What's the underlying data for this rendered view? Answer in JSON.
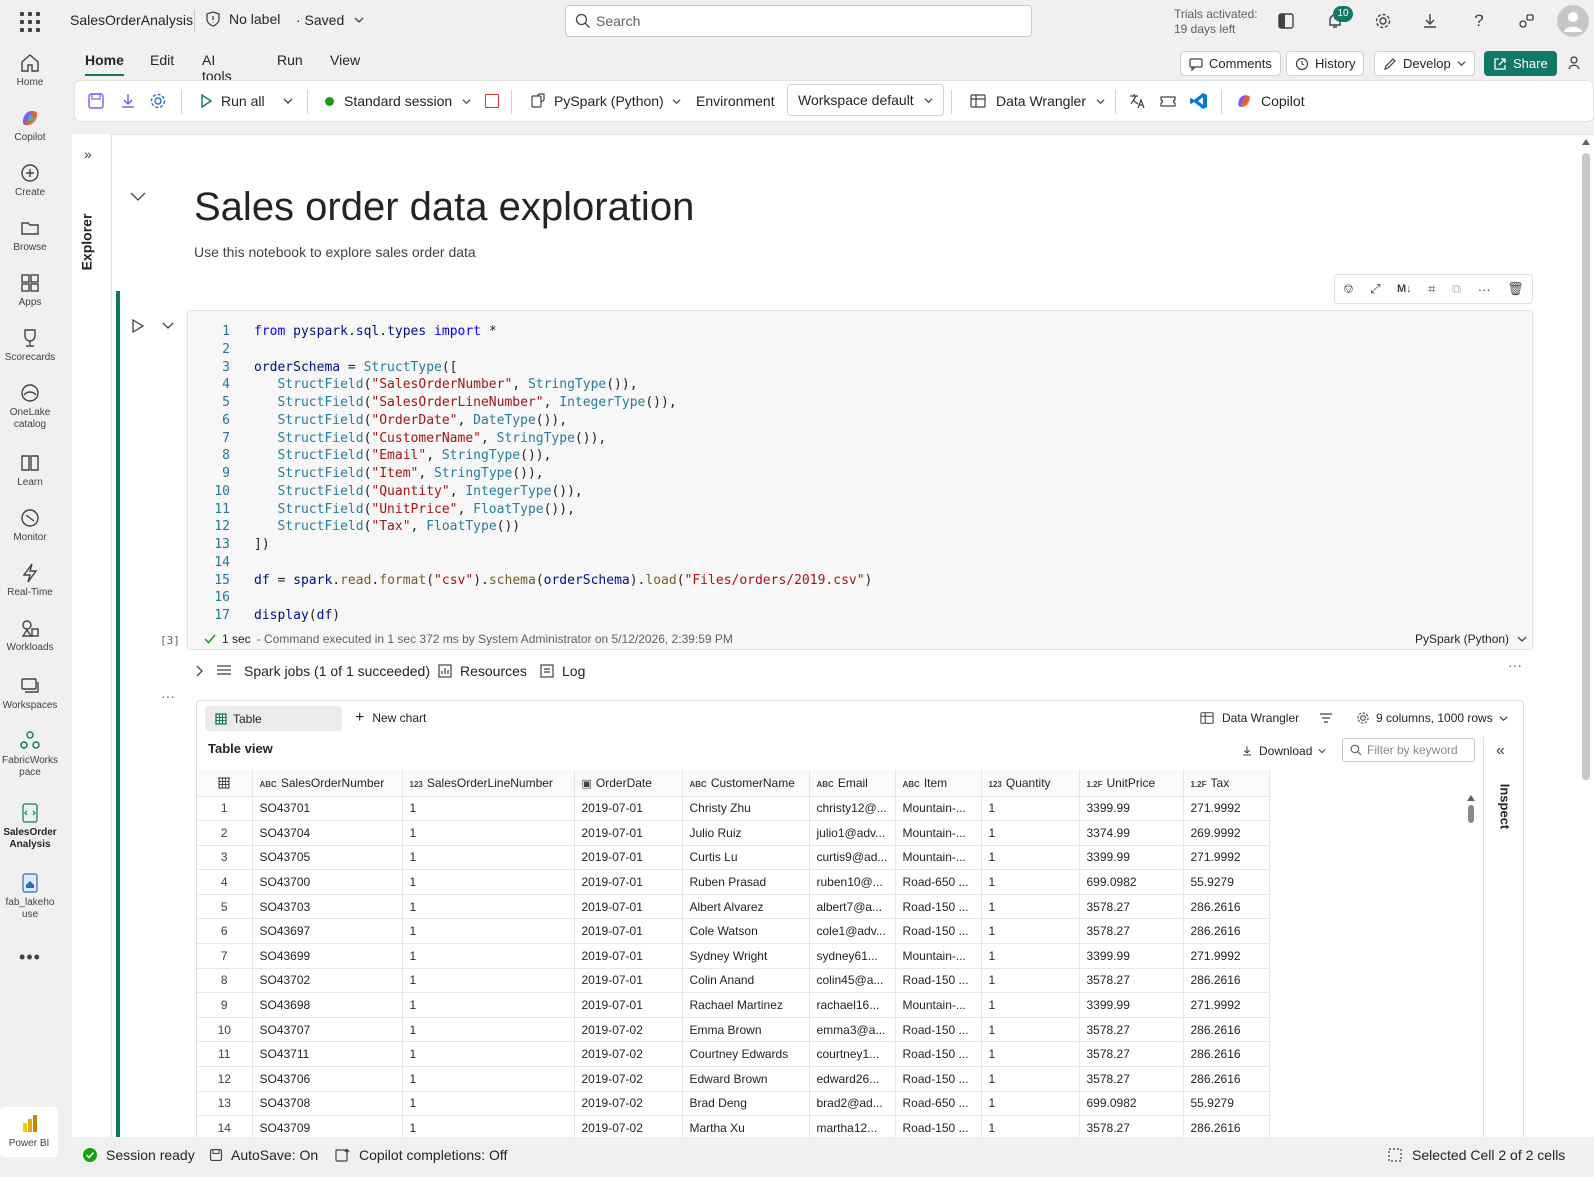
{
  "topbar": {
    "title": "SalesOrderAnalysis",
    "label": "No label",
    "saved": "· Saved",
    "search_placeholder": "Search",
    "trial_line1": "Trials activated:",
    "trial_line2": "19 days left",
    "notification_count": "10"
  },
  "rail": [
    {
      "label": "Home",
      "icon": "home-icon"
    },
    {
      "label": "Copilot",
      "icon": "copilot-icon"
    },
    {
      "label": "Create",
      "icon": "plus-circle-icon"
    },
    {
      "label": "Browse",
      "icon": "folder-icon"
    },
    {
      "label": "Apps",
      "icon": "apps-icon"
    },
    {
      "label": "Scorecards",
      "icon": "trophy-icon"
    },
    {
      "label": "OneLake catalog",
      "icon": "onelake-icon"
    },
    {
      "label": "Learn",
      "icon": "book-icon"
    },
    {
      "label": "Monitor",
      "icon": "monitor-icon"
    },
    {
      "label": "Real-Time",
      "icon": "lightning-icon"
    },
    {
      "label": "Workloads",
      "icon": "workloads-icon"
    },
    {
      "label": "Workspaces",
      "icon": "workspaces-icon"
    },
    {
      "label": "FabricWorkspace",
      "icon": "fabric-workspace-icon"
    },
    {
      "label": "SalesOrderAnalysis",
      "icon": "notebook-icon"
    },
    {
      "label": "fab_lakehouse",
      "icon": "lakehouse-icon"
    },
    {
      "label": "Power BI",
      "icon": "powerbi-icon"
    }
  ],
  "ribbon": {
    "tabs": [
      "Home",
      "Edit",
      "AI tools",
      "Run",
      "View"
    ],
    "comments": "Comments",
    "history": "History",
    "develop": "Develop",
    "share": "Share",
    "run_all": "Run all",
    "session": "Standard session",
    "language": "PySpark (Python)",
    "environment": "Environment",
    "workspace_default": "Workspace default",
    "data_wrangler": "Data Wrangler",
    "copilot": "Copilot"
  },
  "explorer": {
    "label": "Explorer"
  },
  "notebook": {
    "title": "Sales order data exploration",
    "subtitle": "Use this notebook to explore sales order data"
  },
  "cell": {
    "exec_count": "[3]",
    "status_time": "1 sec",
    "status_text": "- Command executed in 1 sec 372 ms by System Administrator on 5/12/2026, 2:39:59 PM",
    "language": "PySpark (Python)",
    "spark_jobs": "Spark jobs (1 of 1 succeeded)",
    "resources": "Resources",
    "log": "Log",
    "code_lines": [
      "from pyspark.sql.types import *",
      "",
      "orderSchema = StructType([",
      "   StructField(\"SalesOrderNumber\", StringType()),",
      "   StructField(\"SalesOrderLineNumber\", IntegerType()),",
      "   StructField(\"OrderDate\", DateType()),",
      "   StructField(\"CustomerName\", StringType()),",
      "   StructField(\"Email\", StringType()),",
      "   StructField(\"Item\", StringType()),",
      "   StructField(\"Quantity\", IntegerType()),",
      "   StructField(\"UnitPrice\", FloatType()),",
      "   StructField(\"Tax\", FloatType())",
      "])",
      "",
      "df = spark.read.format(\"csv\").schema(orderSchema).load(\"Files/orders/2019.csv\")",
      "",
      "display(df)"
    ]
  },
  "output": {
    "table_tab": "Table",
    "new_chart": "New chart",
    "data_wrangler": "Data Wrangler",
    "summary": "9 columns, 1000 rows",
    "table_view": "Table view",
    "download": "Download",
    "filter_placeholder": "Filter by keyword",
    "inspect": "Inspect",
    "columns": [
      {
        "type": "ABC",
        "name": "SalesOrderNumber"
      },
      {
        "type": "123",
        "name": "SalesOrderLineNumber"
      },
      {
        "type": "DATE",
        "name": "OrderDate"
      },
      {
        "type": "ABC",
        "name": "CustomerName"
      },
      {
        "type": "ABC",
        "name": "Email"
      },
      {
        "type": "ABC",
        "name": "Item"
      },
      {
        "type": "123",
        "name": "Quantity"
      },
      {
        "type": "1.2F",
        "name": "UnitPrice"
      },
      {
        "type": "1.2F",
        "name": "Tax"
      }
    ],
    "rows": [
      [
        "1",
        "SO43701",
        "1",
        "2019-07-01",
        "Christy Zhu",
        "christy12@...",
        "Mountain-...",
        "1",
        "3399.99",
        "271.9992"
      ],
      [
        "2",
        "SO43704",
        "1",
        "2019-07-01",
        "Julio Ruiz",
        "julio1@adv...",
        "Mountain-...",
        "1",
        "3374.99",
        "269.9992"
      ],
      [
        "3",
        "SO43705",
        "1",
        "2019-07-01",
        "Curtis Lu",
        "curtis9@ad...",
        "Mountain-...",
        "1",
        "3399.99",
        "271.9992"
      ],
      [
        "4",
        "SO43700",
        "1",
        "2019-07-01",
        "Ruben Prasad",
        "ruben10@...",
        "Road-650 ...",
        "1",
        "699.0982",
        "55.9279"
      ],
      [
        "5",
        "SO43703",
        "1",
        "2019-07-01",
        "Albert Alvarez",
        "albert7@a...",
        "Road-150 ...",
        "1",
        "3578.27",
        "286.2616"
      ],
      [
        "6",
        "SO43697",
        "1",
        "2019-07-01",
        "Cole Watson",
        "cole1@adv...",
        "Road-150 ...",
        "1",
        "3578.27",
        "286.2616"
      ],
      [
        "7",
        "SO43699",
        "1",
        "2019-07-01",
        "Sydney Wright",
        "sydney61...",
        "Mountain-...",
        "1",
        "3399.99",
        "271.9992"
      ],
      [
        "8",
        "SO43702",
        "1",
        "2019-07-01",
        "Colin Anand",
        "colin45@a...",
        "Road-150 ...",
        "1",
        "3578.27",
        "286.2616"
      ],
      [
        "9",
        "SO43698",
        "1",
        "2019-07-01",
        "Rachael Martinez",
        "rachael16...",
        "Mountain-...",
        "1",
        "3399.99",
        "271.9992"
      ],
      [
        "10",
        "SO43707",
        "1",
        "2019-07-02",
        "Emma Brown",
        "emma3@a...",
        "Road-150 ...",
        "1",
        "3578.27",
        "286.2616"
      ],
      [
        "11",
        "SO43711",
        "1",
        "2019-07-02",
        "Courtney Edwards",
        "courtney1...",
        "Road-150 ...",
        "1",
        "3578.27",
        "286.2616"
      ],
      [
        "12",
        "SO43706",
        "1",
        "2019-07-02",
        "Edward Brown",
        "edward26...",
        "Road-150 ...",
        "1",
        "3578.27",
        "286.2616"
      ],
      [
        "13",
        "SO43708",
        "1",
        "2019-07-02",
        "Brad Deng",
        "brad2@ad...",
        "Road-650 ...",
        "1",
        "699.0982",
        "55.9279"
      ],
      [
        "14",
        "SO43709",
        "1",
        "2019-07-02",
        "Martha Xu",
        "martha12...",
        "Road-150 ...",
        "1",
        "3578.27",
        "286.2616"
      ]
    ]
  },
  "statusbar": {
    "session": "Session ready",
    "autosave": "AutoSave: On",
    "copilot": "Copilot completions: Off",
    "selection": "Selected Cell 2 of 2 cells"
  },
  "colors": {
    "accent": "#117865",
    "share_bg": "#117865",
    "session_dot": "#13a10e",
    "stop_red": "#d13438"
  }
}
